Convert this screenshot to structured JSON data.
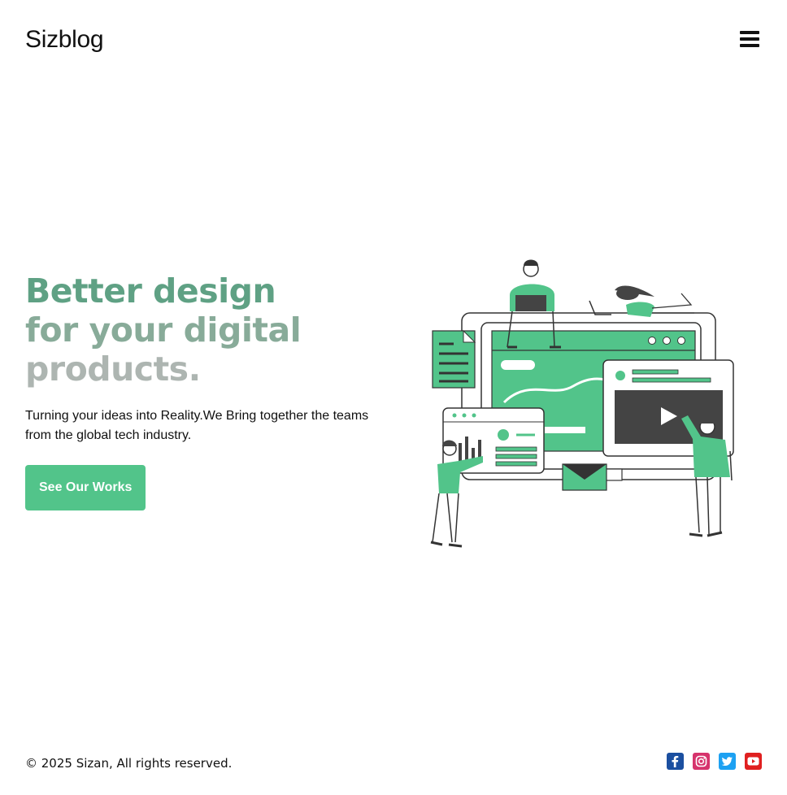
{
  "header": {
    "brand": "Sizblog",
    "menu_icon": "hamburger-menu-icon"
  },
  "hero": {
    "headline_line1": "Better design",
    "headline_line2": "for your digital",
    "headline_line3": "products.",
    "subtitle": "Turning your ideas into Reality.We Bring together the teams from the global tech industry.",
    "cta_label": "See Our Works",
    "illustration_icon": "team-collaboration-illustration"
  },
  "colors": {
    "accent": "#52c48a",
    "headline_1": "#5fa184",
    "headline_2": "#88ab99",
    "headline_3": "#adb5b1",
    "facebook": "#1b4fa0",
    "instagram": "#d6336c",
    "twitter": "#1da1f2",
    "youtube": "#e02020"
  },
  "footer": {
    "copyright": "© 2025 Sizan, All rights reserved.",
    "socials": [
      {
        "name": "facebook",
        "icon": "facebook-icon"
      },
      {
        "name": "instagram",
        "icon": "instagram-icon"
      },
      {
        "name": "twitter",
        "icon": "twitter-icon"
      },
      {
        "name": "youtube",
        "icon": "youtube-icon"
      }
    ]
  }
}
